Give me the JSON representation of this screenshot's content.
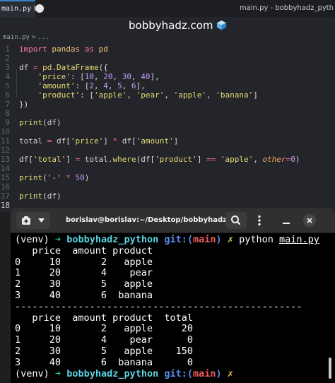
{
  "editor": {
    "tab_filename": "main.py",
    "tab_modified_marker": "M",
    "window_title": "main.py - bobbyhadz_pyth",
    "breadcrumb": {
      "file": "main.py",
      "separator": ">",
      "trail": "..."
    },
    "watermark": "bobbyhadz.com",
    "line_numbers": [
      "1",
      "2",
      "3",
      "4",
      "5",
      "6",
      "7",
      "8",
      "9",
      "10",
      "11",
      "12",
      "13",
      "14",
      "15",
      "16",
      "17",
      "18"
    ],
    "code": {
      "l1": {
        "kw": "import",
        "mod": "pandas",
        "as": "as",
        "alias": "pd"
      },
      "l3": {
        "var": "df",
        "eq": " = ",
        "obj": "pd",
        "fn": "DataFrame",
        "open": "({"
      },
      "l4": {
        "key": "'price'",
        "colon": ": [",
        "v1": "10",
        "v2": "20",
        "v3": "30",
        "v4": "40",
        "close": "],"
      },
      "l5": {
        "key": "'amount'",
        "colon": ": [",
        "v1": "2",
        "v2": "4",
        "v3": "5",
        "v4": "6",
        "close": "],"
      },
      "l6": {
        "key": "'product'",
        "colon": ": [",
        "s1": "'apple'",
        "s2": "'pear'",
        "s3": "'apple'",
        "s4": "'banana'",
        "close": "]"
      },
      "l7": {
        "text": "})"
      },
      "l9": {
        "fn": "print",
        "arg": "(df)"
      },
      "l11": {
        "var": "total",
        "eq": " = ",
        "a": "df[",
        "k1": "'price'",
        "b": "] ",
        "op": "*",
        "c": " df[",
        "k2": "'amount'",
        "d": "]"
      },
      "l13": {
        "a": "df[",
        "k1": "'total'",
        "b": "] ",
        "eq": "=",
        "c": " total.",
        "fn": "where",
        "d": "(df[",
        "k2": "'product'",
        "e": "] ",
        "op": "==",
        "f": " ",
        "k3": "'apple'",
        "g": ", ",
        "param": "other",
        "h": "=",
        "num": "0",
        "i": ")"
      },
      "l15": {
        "fn": "print",
        "a": "(",
        "str": "'-'",
        "op": " * ",
        "num": "50",
        "b": ")"
      },
      "l17": {
        "fn": "print",
        "arg": "(df)"
      }
    }
  },
  "terminal": {
    "title": "borislav@borislav:~/Desktop/bobbyhadz_...",
    "prompt": {
      "venv": "(venv)",
      "arrow": "➜",
      "dir": "bobbyhadz_python",
      "git": "git:(",
      "branch": "main",
      "git_close": ")",
      "x": "✗"
    },
    "command": "python",
    "command_arg": "main.py",
    "output1_header": "   price  amount product",
    "output1_rows": [
      "0     10       2   apple",
      "1     20       4    pear",
      "2     30       5   apple",
      "3     40       6  banana"
    ],
    "separator": "--------------------------------------------------",
    "output2_header": "   price  amount product  total",
    "output2_rows": [
      "0     10       2   apple     20",
      "1     20       4    pear      0",
      "2     30       5   apple    150",
      "3     40       6  banana      0"
    ]
  }
}
